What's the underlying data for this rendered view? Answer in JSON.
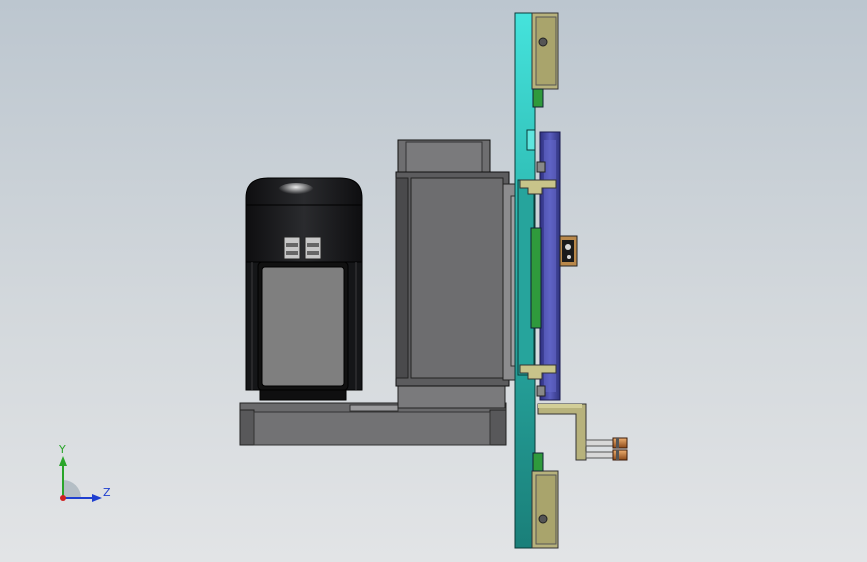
{
  "window": {
    "title": ""
  },
  "colors": {
    "background_top": "#bcc6cf",
    "background_bottom": "#e2e4e6",
    "cyan_plate": "#3fd8d0",
    "teal_plate": "#1f8f88",
    "khaki_block": "#b8b47a",
    "purple_plate": "#4c50a8",
    "green_strip": "#2f9a3c",
    "motor_dark": "#1c1d1f",
    "motor_grey": "#8a8a8a",
    "gearbox_grey": "#6e6e70",
    "copper_fitting": "#c87a3a"
  },
  "triad": {
    "y_label": "Y",
    "z_label": "Z",
    "y_color": "#2aa52a",
    "z_color": "#1f3fd0",
    "x_color": "#d02020"
  },
  "model": {
    "icons": [
      "motor-icon",
      "gearbox-icon",
      "mounting-plate-icon",
      "clamp-block-icon",
      "fitting-icon"
    ]
  }
}
